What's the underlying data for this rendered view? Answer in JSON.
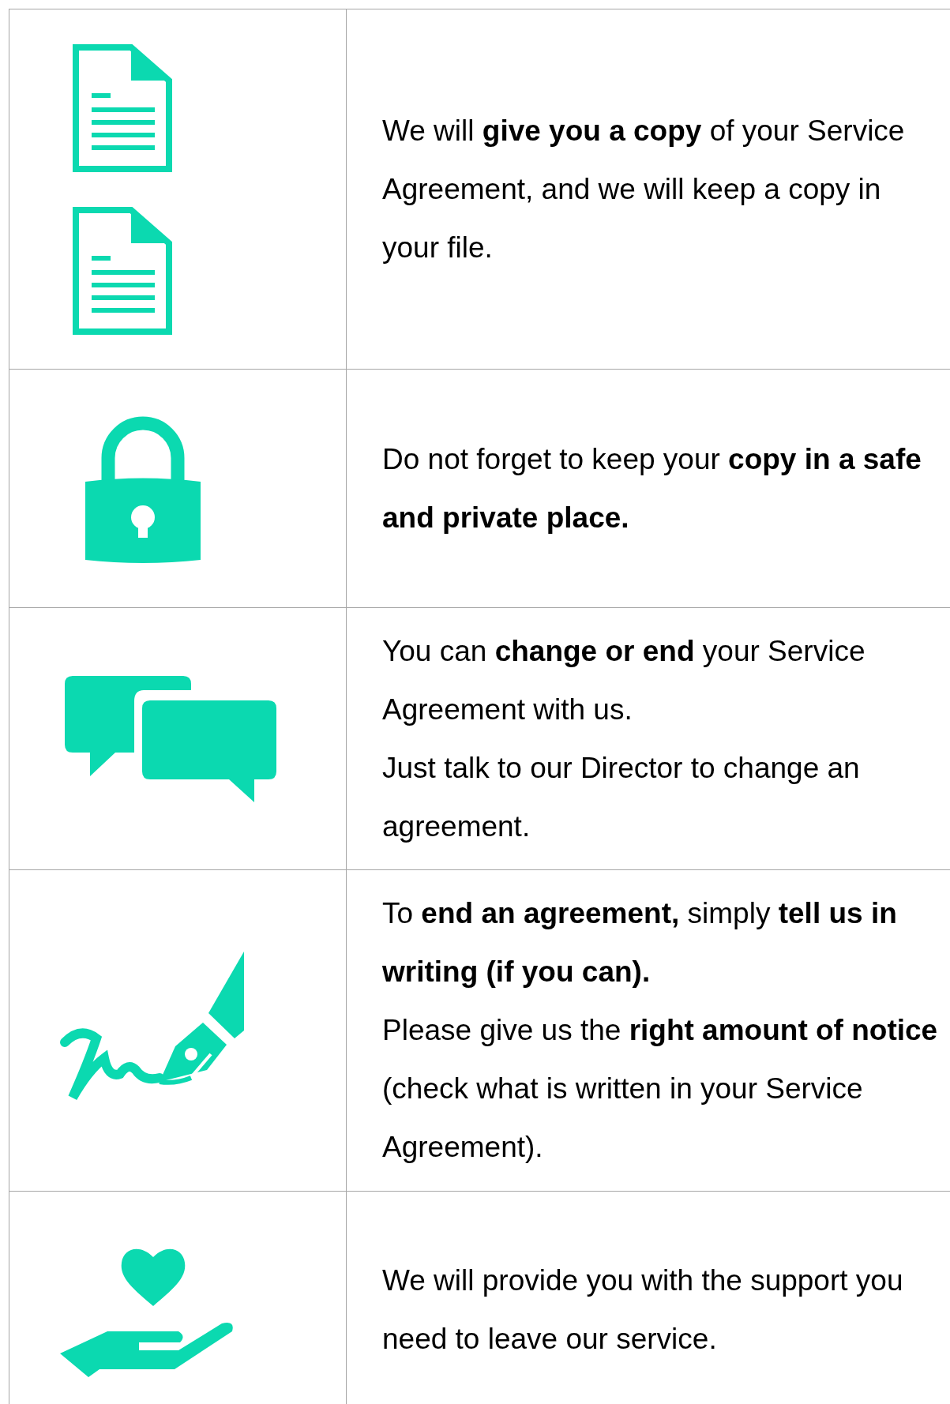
{
  "rows": [
    {
      "kind": "documents",
      "paragraphs": [
        "We will **give you a copy** of your Service Agreement, and we will keep a copy in your file."
      ]
    },
    {
      "kind": "lock",
      "paragraphs": [
        "Do not forget to keep your **copy in a safe and private place.**"
      ]
    },
    {
      "kind": "chat",
      "paragraphs": [
        "You can **change or end** your Service Agreement with us.",
        "Just talk to our Director to change an agreement."
      ]
    },
    {
      "kind": "pen",
      "paragraphs": [
        "To **end an agreement,** simply **tell us in writing (if you can).**",
        "Please give us the **right amount of notice** (check what is written in your Service Agreement)."
      ]
    },
    {
      "kind": "support",
      "paragraphs": [
        "We will provide you with the support you need to leave our service."
      ]
    }
  ]
}
